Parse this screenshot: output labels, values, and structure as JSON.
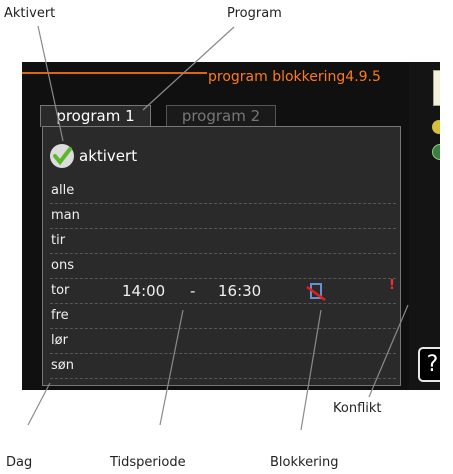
{
  "callouts": {
    "aktivert": "Aktivert",
    "program": "Program",
    "konflikt": "Konflikt",
    "dag": "Dag",
    "tidsperiode": "Tidsperiode",
    "blokkering": "Blokkering"
  },
  "screen": {
    "title": "program blokkering",
    "menu_number": "4.9.5",
    "tabs": [
      {
        "label": "program 1",
        "selected": true
      },
      {
        "label": "program 2",
        "selected": false
      }
    ],
    "activated_label": "aktivert",
    "activated_checked": true,
    "days": [
      "alle",
      "man",
      "tir",
      "ons",
      "tor",
      "fre",
      "lør",
      "søn"
    ],
    "schedule": {
      "day": "tor",
      "start": "14:00",
      "separator": "-",
      "end": "16:30"
    },
    "conflict_mark": "!",
    "help_label": "?"
  },
  "colors": {
    "accent_orange": "#ff7a1a",
    "check_green": "#5cb82a",
    "conflict_red": "#ff2a2a",
    "block_icon_slash": "#e02020"
  }
}
